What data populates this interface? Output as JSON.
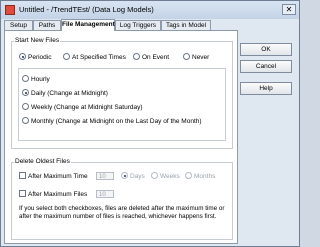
{
  "window": {
    "title": "Untitled - /TrendTEst/ (Data Log Models)",
    "close_symbol": "✕"
  },
  "tabs": [
    {
      "label": "Setup"
    },
    {
      "label": "Paths"
    },
    {
      "label": "File Management",
      "active": true
    },
    {
      "label": "Log Triggers"
    },
    {
      "label": "Tags in Model"
    }
  ],
  "buttons": {
    "ok": "OK",
    "cancel": "Cancel",
    "help": "Help"
  },
  "start_new_files": {
    "label": "Start New Files",
    "modes": [
      {
        "label": "Periodic",
        "selected": true
      },
      {
        "label": "At Specified Times",
        "selected": false
      },
      {
        "label": "On Event",
        "selected": false
      },
      {
        "label": "Never",
        "selected": false
      }
    ],
    "intervals": [
      {
        "label": "Hourly",
        "selected": false
      },
      {
        "label": "Daily (Change at Midnight)",
        "selected": true
      },
      {
        "label": "Weekly (Change at Midnight Saturday)",
        "selected": false
      },
      {
        "label": "Monthly (Change at Midnight on the Last Day of the Month)",
        "selected": false
      }
    ]
  },
  "delete_oldest_files": {
    "label": "Delete Oldest Files",
    "after_max_time": {
      "label": "After Maximum Time",
      "value": "10",
      "checked": false
    },
    "after_max_files": {
      "label": "After Maximum Files",
      "value": "10",
      "checked": false
    },
    "units": [
      {
        "label": "Days",
        "selected": true
      },
      {
        "label": "Weeks",
        "selected": false
      },
      {
        "label": "Months",
        "selected": false
      }
    ],
    "note": "If you select both checkboxes, files are deleted after the maximum time or after the maximum number of files is reached, whichever happens first."
  }
}
